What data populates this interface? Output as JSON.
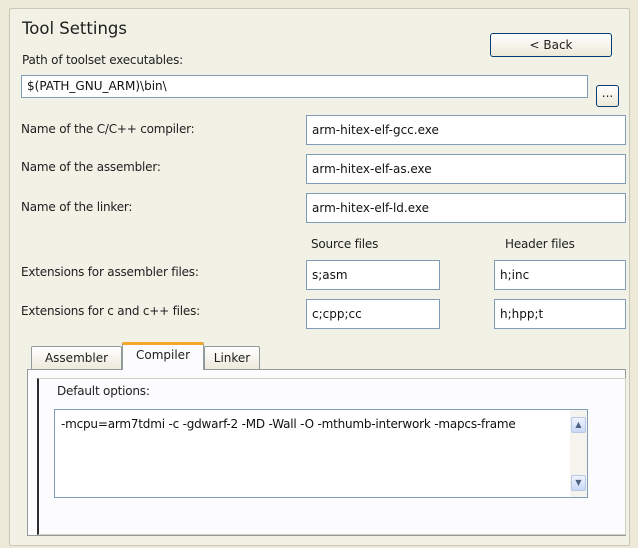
{
  "header": {
    "title": "Tool Settings",
    "back_label": "< Back"
  },
  "toolset_path": {
    "label": "Path of toolset executables:",
    "value": "$(PATH_GNU_ARM)\\bin\\",
    "browse_label": "..."
  },
  "compiler": {
    "label": "Name of the C/C++ compiler:",
    "value": "arm-hitex-elf-gcc.exe"
  },
  "assembler": {
    "label": "Name of the assembler:",
    "value": "arm-hitex-elf-as.exe"
  },
  "linker": {
    "label": "Name of the linker:",
    "value": "arm-hitex-elf-ld.exe"
  },
  "extensions": {
    "source_header": "Source files",
    "header_header": "Header files",
    "assembler_label": "Extensions for assembler files:",
    "assembler_source": "s;asm",
    "assembler_header": "h;inc",
    "c_label": "Extensions for c and c++ files:",
    "c_source": "c;cpp;cc",
    "c_header": "h;hpp;t"
  },
  "tabs": [
    {
      "label": "Assembler",
      "active": false
    },
    {
      "label": "Compiler",
      "active": true
    },
    {
      "label": "Linker",
      "active": false
    }
  ],
  "options": {
    "label": "Default options:",
    "value": "-mcpu=arm7tdmi -c -gdwarf-2 -MD -Wall -O -mthumb-interwork -mapcs-frame"
  },
  "colors": {
    "active_tab_accent": "#f4a82a",
    "field_border": "#7f9db9",
    "panel_bg": "#f2f1e6"
  }
}
